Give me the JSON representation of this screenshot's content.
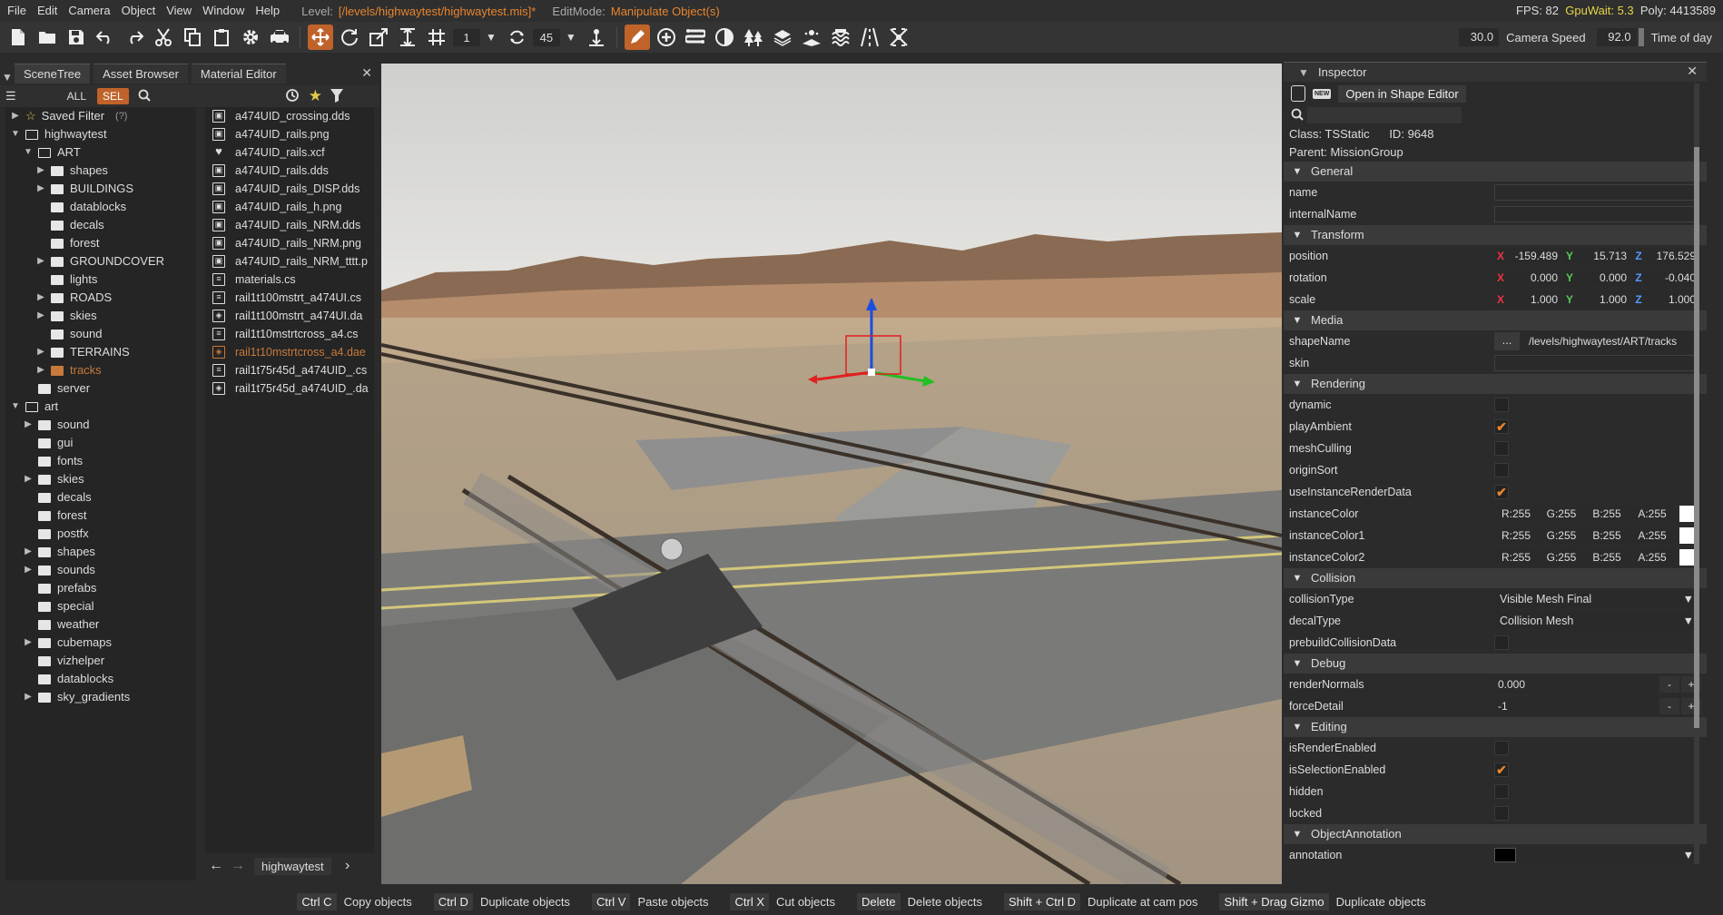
{
  "menubar": {
    "items": [
      "File",
      "Edit",
      "Camera",
      "Object",
      "View",
      "Window",
      "Help"
    ],
    "level_label": "Level:",
    "level_value": "[/levels/highwaytest/highwaytest.mis]*",
    "editmode_label": "EditMode:",
    "editmode_value": "Manipulate Object(s)",
    "fps": "FPS: 82",
    "gpuwait": "GpuWait: 5.3",
    "poly": "Poly: 4413589"
  },
  "toolbar": {
    "grid_value": "1",
    "angle_value": "45"
  },
  "camera": {
    "fov_value": "30.0",
    "speed_label": "Camera Speed",
    "speed_value": "92.0",
    "time_label": "Time of day"
  },
  "left_panel": {
    "tabs": [
      "SceneTree",
      "Asset Browser",
      "Material Editor"
    ],
    "filter_all": "ALL",
    "filter_sel": "SEL",
    "tree": [
      {
        "label": "Saved Filter",
        "extra": "(?)",
        "depth": 0,
        "exp": ">",
        "type": "star"
      },
      {
        "label": "highwaytest",
        "depth": 0,
        "exp": "v",
        "type": "folder"
      },
      {
        "label": "ART",
        "depth": 1,
        "exp": "v",
        "type": "folder"
      },
      {
        "label": "shapes",
        "depth": 2,
        "exp": ">",
        "type": "filled"
      },
      {
        "label": "BUILDINGS",
        "depth": 2,
        "exp": ">",
        "type": "filled"
      },
      {
        "label": "datablocks",
        "depth": 2,
        "exp": "",
        "type": "filled"
      },
      {
        "label": "decals",
        "depth": 2,
        "exp": "",
        "type": "filled"
      },
      {
        "label": "forest",
        "depth": 2,
        "exp": "",
        "type": "filled"
      },
      {
        "label": "GROUNDCOVER",
        "depth": 2,
        "exp": ">",
        "type": "filled"
      },
      {
        "label": "lights",
        "depth": 2,
        "exp": "",
        "type": "filled"
      },
      {
        "label": "ROADS",
        "depth": 2,
        "exp": ">",
        "type": "filled"
      },
      {
        "label": "skies",
        "depth": 2,
        "exp": ">",
        "type": "filled"
      },
      {
        "label": "sound",
        "depth": 2,
        "exp": "",
        "type": "filled"
      },
      {
        "label": "TERRAINS",
        "depth": 2,
        "exp": ">",
        "type": "filled"
      },
      {
        "label": "tracks",
        "depth": 2,
        "exp": ">",
        "type": "orange"
      },
      {
        "label": "server",
        "depth": 1,
        "exp": "",
        "type": "filled"
      },
      {
        "label": "art",
        "depth": 0,
        "exp": "v",
        "type": "folder"
      },
      {
        "label": "sound",
        "depth": 1,
        "exp": ">",
        "type": "filled"
      },
      {
        "label": "gui",
        "depth": 1,
        "exp": "",
        "type": "filled"
      },
      {
        "label": "fonts",
        "depth": 1,
        "exp": "",
        "type": "filled"
      },
      {
        "label": "skies",
        "depth": 1,
        "exp": ">",
        "type": "filled"
      },
      {
        "label": "decals",
        "depth": 1,
        "exp": "",
        "type": "filled"
      },
      {
        "label": "forest",
        "depth": 1,
        "exp": "",
        "type": "filled"
      },
      {
        "label": "postfx",
        "depth": 1,
        "exp": "",
        "type": "filled"
      },
      {
        "label": "shapes",
        "depth": 1,
        "exp": ">",
        "type": "filled"
      },
      {
        "label": "sounds",
        "depth": 1,
        "exp": ">",
        "type": "filled"
      },
      {
        "label": "prefabs",
        "depth": 1,
        "exp": "",
        "type": "filled"
      },
      {
        "label": "special",
        "depth": 1,
        "exp": "",
        "type": "filled"
      },
      {
        "label": "weather",
        "depth": 1,
        "exp": "",
        "type": "filled"
      },
      {
        "label": "cubemaps",
        "depth": 1,
        "exp": ">",
        "type": "filled"
      },
      {
        "label": "vizhelper",
        "depth": 1,
        "exp": "",
        "type": "filled"
      },
      {
        "label": "datablocks",
        "depth": 1,
        "exp": "",
        "type": "filled"
      },
      {
        "label": "sky_gradients",
        "depth": 1,
        "exp": ">",
        "type": "filled"
      }
    ],
    "files": [
      {
        "name": "a474UID_crossing.dds",
        "icon": "image"
      },
      {
        "name": "a474UID_rails.png",
        "icon": "image"
      },
      {
        "name": "a474UID_rails.xcf",
        "icon": "heart"
      },
      {
        "name": "a474UID_rails.dds",
        "icon": "image"
      },
      {
        "name": "a474UID_rails_DISP.dds",
        "icon": "image"
      },
      {
        "name": "a474UID_rails_h.png",
        "icon": "image"
      },
      {
        "name": "a474UID_rails_NRM.dds",
        "icon": "image"
      },
      {
        "name": "a474UID_rails_NRM.png",
        "icon": "image"
      },
      {
        "name": "a474UID_rails_NRM_tttt.p",
        "icon": "image"
      },
      {
        "name": "materials.cs",
        "icon": "doc"
      },
      {
        "name": "rail1t100mstrt_a474UI.cs",
        "icon": "doc"
      },
      {
        "name": "rail1t100mstrt_a474UI.da",
        "icon": "mesh"
      },
      {
        "name": "rail1t10mstrtcross_a4.cs",
        "icon": "doc"
      },
      {
        "name": "rail1t10mstrtcross_a4.dae",
        "icon": "mesh",
        "orange": true
      },
      {
        "name": "rail1t75r45d_a474UID_.cs",
        "icon": "doc"
      },
      {
        "name": "rail1t75r45d_a474UID_.da",
        "icon": "mesh"
      }
    ],
    "breadcrumb": "highwaytest"
  },
  "inspector": {
    "title": "Inspector",
    "open_shape_editor": "Open in Shape Editor",
    "class_label": "Class:",
    "class_value": "TSStatic",
    "id_label": "ID:",
    "id_value": "9648",
    "parent_label": "Parent:",
    "parent_value": "MissionGroup",
    "sections": {
      "general": "General",
      "transform": "Transform",
      "media": "Media",
      "rendering": "Rendering",
      "collision": "Collision",
      "debug": "Debug",
      "editing": "Editing",
      "annotation": "ObjectAnnotation"
    },
    "general": {
      "name": "name",
      "internal_name": "internalName"
    },
    "transform": {
      "position": {
        "label": "position",
        "x": "-159.489",
        "y": "15.713",
        "z": "176.529"
      },
      "rotation": {
        "label": "rotation",
        "x": "0.000",
        "y": "0.000",
        "z": "-0.040"
      },
      "scale": {
        "label": "scale",
        "x": "1.000",
        "y": "1.000",
        "z": "1.000"
      }
    },
    "media": {
      "shape_label": "shapeName",
      "shape_path": "/levels/highwaytest/ART/tracks",
      "shape_dots": "...",
      "skin_label": "skin"
    },
    "rendering": [
      {
        "label": "dynamic",
        "checked": false
      },
      {
        "label": "playAmbient",
        "checked": true
      },
      {
        "label": "meshCulling",
        "checked": false
      },
      {
        "label": "originSort",
        "checked": false
      },
      {
        "label": "useInstanceRenderData",
        "checked": true
      }
    ],
    "colors": [
      {
        "label": "instanceColor",
        "r": "R:255",
        "g": "G:255",
        "b": "B:255",
        "a": "A:255"
      },
      {
        "label": "instanceColor1",
        "r": "R:255",
        "g": "G:255",
        "b": "B:255",
        "a": "A:255"
      },
      {
        "label": "instanceColor2",
        "r": "R:255",
        "g": "G:255",
        "b": "B:255",
        "a": "A:255"
      }
    ],
    "collision": {
      "type_label": "collisionType",
      "type_value": "Visible Mesh Final",
      "decal_label": "decalType",
      "decal_value": "Collision Mesh",
      "prebuild_label": "prebuildCollisionData"
    },
    "debug": {
      "normals_label": "renderNormals",
      "normals_value": "0.000",
      "detail_label": "forceDetail",
      "detail_value": "-1"
    },
    "editing": [
      {
        "label": "isRenderEnabled",
        "checked": false
      },
      {
        "label": "isSelectionEnabled",
        "checked": true
      },
      {
        "label": "hidden",
        "checked": false
      },
      {
        "label": "locked",
        "checked": false
      }
    ],
    "annotation": {
      "label": "annotation"
    }
  },
  "statusbar": [
    {
      "key": "Ctrl C",
      "action": "Copy objects"
    },
    {
      "key": "Ctrl D",
      "action": "Duplicate objects"
    },
    {
      "key": "Ctrl V",
      "action": "Paste objects"
    },
    {
      "key": "Ctrl X",
      "action": "Cut objects"
    },
    {
      "key": "Delete",
      "action": "Delete objects"
    },
    {
      "key": "Shift + Ctrl D",
      "action": "Duplicate at cam pos"
    },
    {
      "key": "Shift + Drag Gizmo",
      "action": "Duplicate objects"
    }
  ],
  "colors": {
    "accent": "#c0632a",
    "orange_text": "#e8852e",
    "gpu": "#e6d547"
  }
}
